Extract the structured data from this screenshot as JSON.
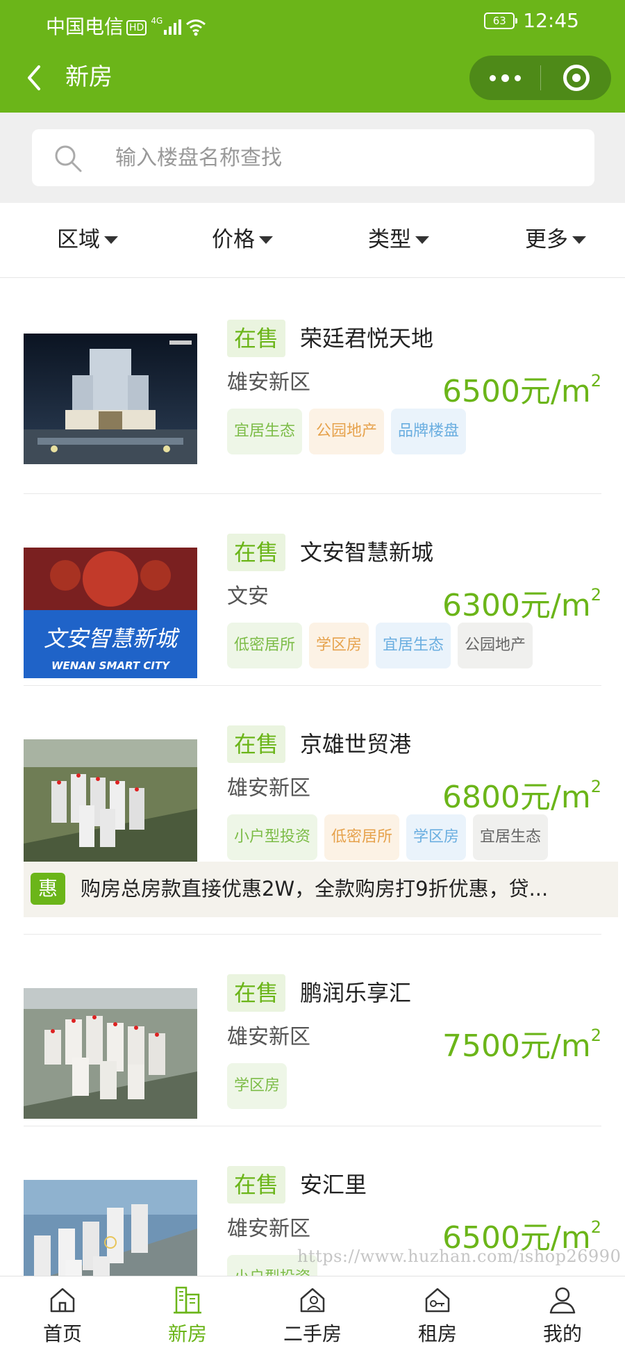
{
  "status_bar": {
    "carrier": "中国电信",
    "hd": "HD",
    "network": "4G",
    "battery": "63",
    "time": "12:45"
  },
  "nav": {
    "title": "新房"
  },
  "search": {
    "placeholder": "输入楼盘名称查找",
    "value": ""
  },
  "filters": [
    {
      "label": "区域"
    },
    {
      "label": "价格"
    },
    {
      "label": "类型"
    },
    {
      "label": "更多"
    }
  ],
  "listings": [
    {
      "status": "在售",
      "name": "荣廷君悦天地",
      "district": "雄安新区",
      "price": "6500元/m",
      "price_unit_sup": "2",
      "tags": [
        {
          "label": "宜居生态",
          "style": "green"
        },
        {
          "label": "公园地产",
          "style": "orange"
        },
        {
          "label": "品牌楼盘",
          "style": "blue"
        }
      ]
    },
    {
      "status": "在售",
      "name": "文安智慧新城",
      "district": "文安",
      "price": "6300元/m",
      "price_unit_sup": "2",
      "image_text": "文安智慧新城",
      "image_subtext": "WENAN SMART CITY",
      "tags": [
        {
          "label": "低密居所",
          "style": "green"
        },
        {
          "label": "学区房",
          "style": "orange"
        },
        {
          "label": "宜居生态",
          "style": "blue"
        },
        {
          "label": "公园地产",
          "style": "gray"
        }
      ]
    },
    {
      "status": "在售",
      "name": "京雄世贸港",
      "district": "雄安新区",
      "price": "6800元/m",
      "price_unit_sup": "2",
      "tags": [
        {
          "label": "小户型投资",
          "style": "green"
        },
        {
          "label": "低密居所",
          "style": "orange"
        },
        {
          "label": "学区房",
          "style": "blue"
        },
        {
          "label": "宜居生态",
          "style": "gray"
        }
      ]
    },
    {
      "status": "在售",
      "name": "鹏润乐享汇",
      "district": "雄安新区",
      "price": "7500元/m",
      "price_unit_sup": "2",
      "tags": [
        {
          "label": "学区房",
          "style": "green"
        }
      ]
    },
    {
      "status": "在售",
      "name": "安汇里",
      "district": "雄安新区",
      "price": "6500元/m",
      "price_unit_sup": "2",
      "tags": [
        {
          "label": "小户型投资",
          "style": "green"
        }
      ]
    }
  ],
  "promo": {
    "icon": "惠",
    "text": "购房总房款直接优惠2W，全款购房打9折优惠，贷..."
  },
  "watermark": "https://www.huzhan.com/ishop26990",
  "tabs": [
    {
      "label": "首页",
      "icon": "home-icon"
    },
    {
      "label": "新房",
      "icon": "building-icon",
      "active": true
    },
    {
      "label": "二手房",
      "icon": "house-person-icon"
    },
    {
      "label": "租房",
      "icon": "house-key-icon"
    },
    {
      "label": "我的",
      "icon": "user-icon"
    }
  ],
  "colors": {
    "brand_green": "#6bb519",
    "capsule_green": "#4e8a18",
    "tag_orange": "#e6a24c",
    "tag_blue": "#6aaee0"
  }
}
